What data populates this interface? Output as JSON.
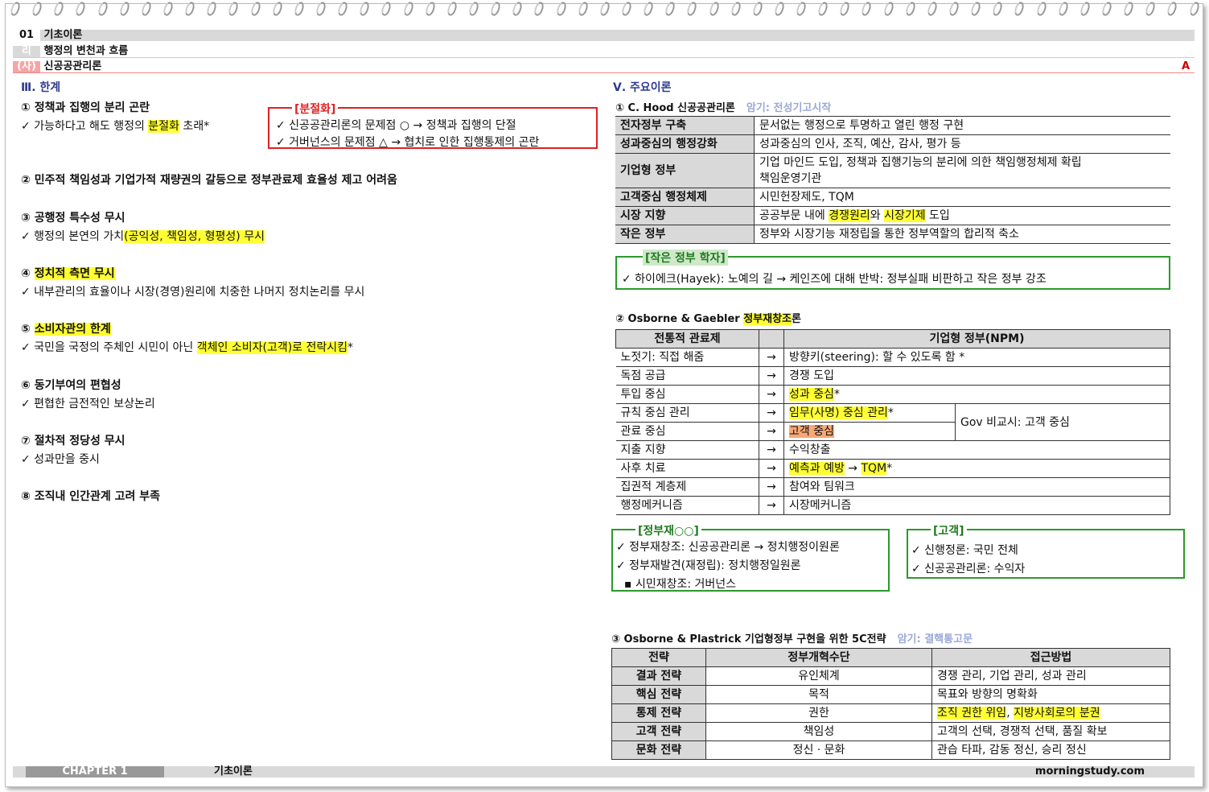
{
  "header": {
    "ch_num": "01",
    "ch_title": "기초이론",
    "sec_num": "리",
    "sec_title": "행정의 변천과 흐름",
    "sub_num": "(사)",
    "sub_title": "신공공관리론",
    "mark": "A"
  },
  "left": {
    "heading": "Ⅲ. 한계",
    "i1_title": "① 정책과 집행의 분리 곤란",
    "i1_a": "✓ 가능하다고 해도 행정의 ",
    "i1_b": "분절화",
    "i1_c": " 초래*",
    "box_title": "[분절화]",
    "box_l1": "✓ 신공공관리론의 문제점 ○ → 정책과 집행의 단절",
    "box_l2": "✓ 거버넌스의 문제점 △ → 협치로 인한 집행통제의 곤란",
    "i2_title": "② 민주적 책임성과 기업가적 재량권의 갈등으로 정부관료제 효율성 제고 어려움",
    "i3_title": "③ 공행정 특수성 무시",
    "i3_a": "✓ 행정의 본연의 가치",
    "i3_b": "(공익성, 책임성, 형평성) 무시",
    "i4_a": "④ ",
    "i4_b": "정치적 측면 무시",
    "i4_l": "✓ 내부관리의 효율이나 시장(경영)원리에 치중한 나머지 정치논리를 무시",
    "i5_a": "⑤ ",
    "i5_b": "소비자관의 한계",
    "i5_c": "✓ 국민을 국정의 주체인 시민이 아닌 ",
    "i5_d": "객체인 소비자(고객)로 전락시킴",
    "i5_e": "*",
    "i6_title": "⑥ 동기부여의 편협성",
    "i6_l": "✓ 편협한 금전적인 보상논리",
    "i7_title": "⑦ 절차적 정당성 무시",
    "i7_l": "✓ 성과만을 중시",
    "i8_title": "⑧ 조직내 인간관계 고려 부족"
  },
  "right": {
    "heading": "Ⅴ. 주요이론",
    "s1_title": "① C. Hood 신공공관리론",
    "s1_hint": "암기: 전성기고시작",
    "hood": [
      [
        "전자정부 구축",
        "문서없는 행정으로 투명하고 열린 행정 구현"
      ],
      [
        "성과중심의 행정강화",
        "성과중심의 인사, 조직, 예산, 감사, 평가 등"
      ],
      [
        "기업형 정부",
        "기업 마인드 도입, 정책과 집행기능의 분리에 의한 책임행정체제 확립",
        "책임운영기관"
      ],
      [
        "고객중심 행정체제",
        "시민헌장제도, TQM"
      ],
      [
        "시장 지향",
        "공공부문 내에 ",
        "경쟁원리",
        "와 ",
        "시장기제",
        " 도입"
      ],
      [
        "작은 정부",
        "정부와 시장기능 재정립을 통한 정부역할의 합리적 축소"
      ]
    ],
    "small_title": "[작은 정부 학자]",
    "small_l": "✓ 하이에크(Hayek): 노예의 길 → 케인즈에 대해 반박: 정부실패 비판하고 작은 정부 강조",
    "s2_a": "② Osborne & Gaebler ",
    "s2_b": "정부재창조",
    "s2_c": "론",
    "t2_h1": "전통적 관료제",
    "t2_h2": "기업형 정부(NPM)",
    "t2": [
      [
        "노젓기: 직접 해줌",
        "→",
        "방향키(steering): 할 수 있도록 함 *"
      ],
      [
        "독점 공급",
        "→",
        "경쟁 도입"
      ],
      [
        "투입 중심",
        "→",
        "성과 중심",
        "*"
      ],
      [
        "규칙 중심 관리",
        "→",
        "임무(사명) 중심 관리",
        "*"
      ],
      [
        "관료 중심",
        "→",
        "고객 중심"
      ],
      [
        "지출 지향",
        "→",
        "수익창출"
      ],
      [
        "사후 치료",
        "→",
        "예측과 예방",
        " → ",
        "TQM",
        "*"
      ],
      [
        "집권적 계층제",
        "→",
        "참여와 팀워크"
      ],
      [
        "행정메커니즘",
        "→",
        "시장메커니즘"
      ]
    ],
    "gov_cmp": "Gov 비교시: 고객 중심",
    "g1_title": "[정부재○○]",
    "g1_l1": "✓ 정부재창조: 신공공관리론 → 정치행정이원론",
    "g1_l2": "✓ 정부재발견(재정립): 정치행정일원론",
    "g1_l3": "▪ 시민재창조: 거버넌스",
    "g2_title": "[고객]",
    "g2_l1": "✓ 신행정론: 국민 전체",
    "g2_l2": "✓ 신공공관리론: 수익자",
    "s3_title": "③ Osborne & Plastrick 기업형정부 구현을 위한 5C전략",
    "s3_hint": "암기: 결핵통고문",
    "t3_h": [
      "전략",
      "정부개혁수단",
      "접근방법"
    ],
    "t3": [
      [
        "결과 전략",
        "유인체계",
        "경쟁 관리, 기업 관리, 성과 관리"
      ],
      [
        "핵심 전략",
        "목적",
        "목표와 방향의 명확화"
      ],
      [
        "통제 전략",
        "권한",
        "조직 권한 위임",
        ", ",
        "지방사회로의 분권"
      ],
      [
        "고객 전략",
        "책임성",
        "고객의 선택, 경쟁적 선택, 품질 확보"
      ],
      [
        "문화 전략",
        "정신 · 문화",
        "관습 타파, 감동 정신, 승리 정신"
      ]
    ]
  },
  "footer": {
    "chapter": "CHAPTER 1",
    "label": "기초이론",
    "site": "morningstudy.com"
  }
}
